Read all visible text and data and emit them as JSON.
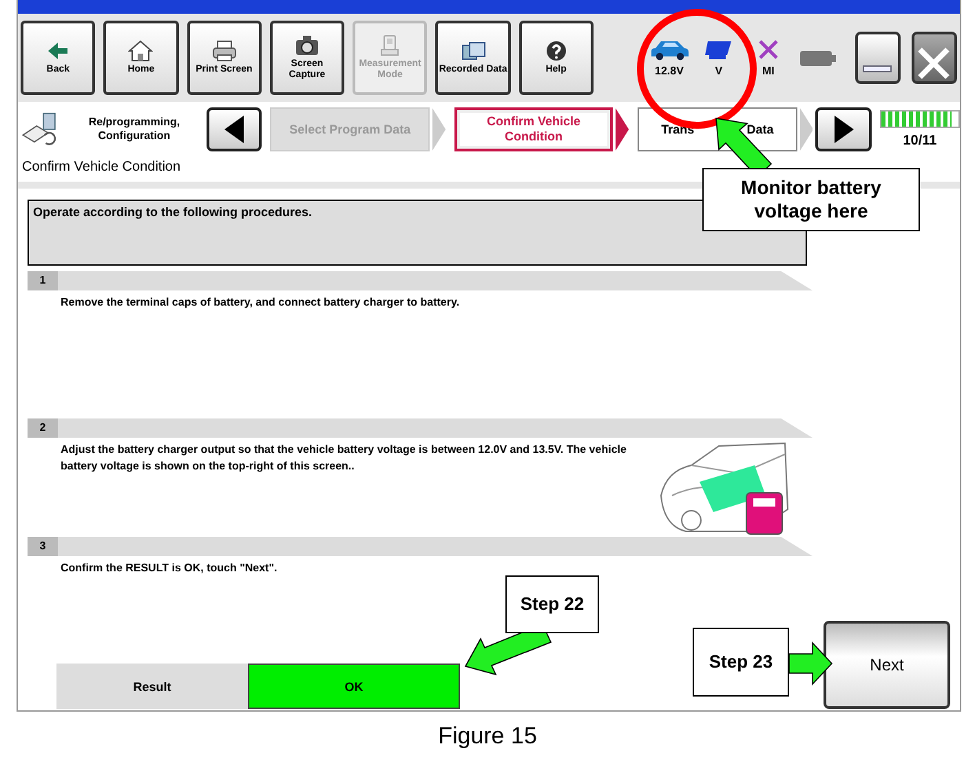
{
  "toolbar": {
    "buttons": [
      {
        "label": "Back",
        "disabled": false
      },
      {
        "label": "Home",
        "disabled": false
      },
      {
        "label": "Print Screen",
        "disabled": false
      },
      {
        "label": "Screen Capture",
        "disabled": false
      },
      {
        "label": "Measurement Mode",
        "disabled": true
      },
      {
        "label": "Recorded Data",
        "disabled": false
      },
      {
        "label": "Help",
        "disabled": false
      }
    ],
    "status": {
      "voltage": "12.8V",
      "vi_label": "V",
      "mi_label": "MI"
    }
  },
  "nav": {
    "section": "Re/programming, Configuration",
    "steps": [
      {
        "label_parts": [
          "Select Program Data"
        ],
        "selected": false,
        "disabled": true
      },
      {
        "label_parts": [
          "Confirm Vehicle Condition"
        ],
        "selected": true,
        "disabled": false
      },
      {
        "label_parts": [
          "Trans",
          "Data"
        ],
        "selected": false,
        "disabled": false
      }
    ],
    "progress": {
      "level": 0.91,
      "text": "10/11"
    }
  },
  "section_title": "Confirm Vehicle Condition",
  "instruction": "Operate according to the following procedures.",
  "procedure_steps": [
    {
      "number": "1",
      "text": "Remove the terminal caps of battery, and connect battery charger to battery."
    },
    {
      "number": "2",
      "text": "Adjust the battery charger output so that the vehicle battery voltage is between 12.0V and 13.5V. The vehicle battery voltage is shown on the top-right of this screen..",
      "kind": "illustrated"
    },
    {
      "number": "3",
      "text": "Confirm the RESULT is OK, touch \"Next\"."
    }
  ],
  "result": {
    "label": "Result",
    "value": "OK",
    "passed": true
  },
  "next_button": "Next",
  "callouts": [
    {
      "text": "Monitor battery voltage here"
    },
    {
      "text": "Step 22"
    },
    {
      "text": "Step 23"
    }
  ],
  "caption": "Figure 15"
}
